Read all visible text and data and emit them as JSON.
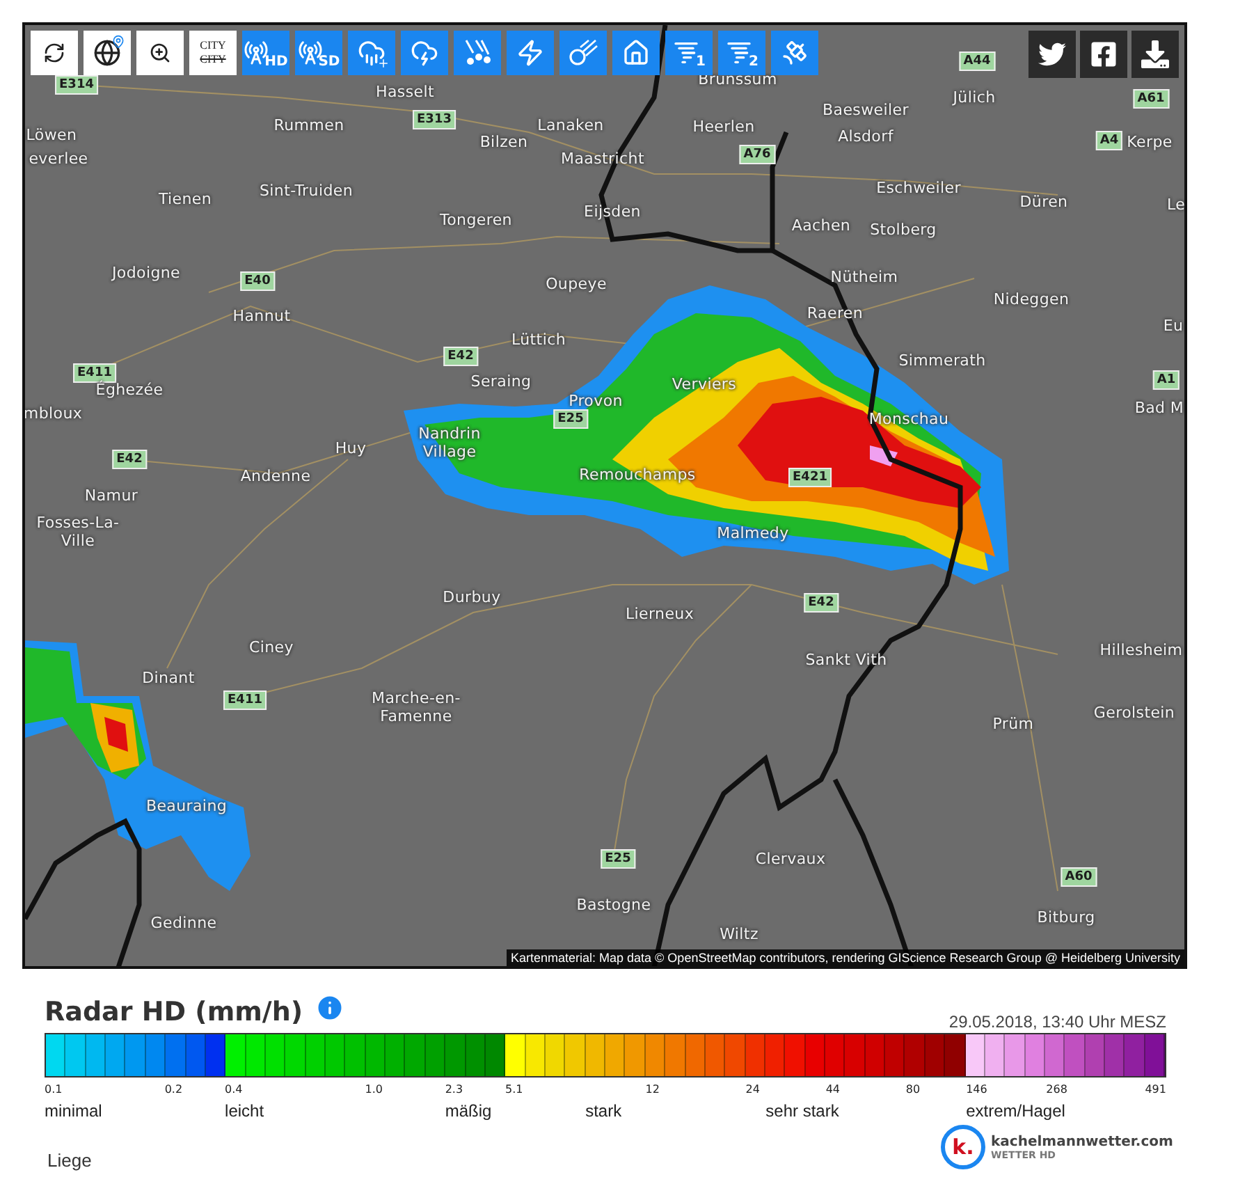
{
  "toolbar": {
    "tools": [
      {
        "kind": "refresh",
        "color": "#ffffff"
      },
      {
        "kind": "globe",
        "color": "#ffffff"
      },
      {
        "kind": "zoom",
        "color": "#ffffff"
      },
      {
        "kind": "city",
        "color": "#ffffff",
        "label": "CITY",
        "struck_label": "CITY"
      },
      {
        "kind": "radar",
        "color": "#1a86f0",
        "label": "HD"
      },
      {
        "kind": "radar",
        "color": "#1a86f0",
        "label": "SD"
      },
      {
        "kind": "cloudplus",
        "color": "#1a86f0"
      },
      {
        "kind": "storm",
        "color": "#1a86f0"
      },
      {
        "kind": "hail",
        "color": "#1a86f0"
      },
      {
        "kind": "lightning",
        "color": "#1a86f0"
      },
      {
        "kind": "meteor",
        "color": "#1a86f0"
      },
      {
        "kind": "flood",
        "color": "#1a86f0"
      },
      {
        "kind": "tornado",
        "color": "#1a86f0",
        "label": "1"
      },
      {
        "kind": "tornado",
        "color": "#1a86f0",
        "label": "2"
      },
      {
        "kind": "satellite",
        "color": "#1a86f0"
      }
    ],
    "share": [
      {
        "kind": "twitter"
      },
      {
        "kind": "facebook"
      },
      {
        "kind": "download"
      }
    ]
  },
  "map": {
    "labels": [
      {
        "kind": "road",
        "text": "E314"
      },
      {
        "kind": "city",
        "text": "Hasselt"
      },
      {
        "kind": "city",
        "text": "Brunssum"
      },
      {
        "kind": "road",
        "text": "A44"
      },
      {
        "kind": "city",
        "text": "Jülich"
      },
      {
        "kind": "road",
        "text": "A61"
      },
      {
        "kind": "city",
        "text": "Löwen"
      },
      {
        "kind": "road",
        "text": "E313"
      },
      {
        "kind": "city",
        "text": "Rummen"
      },
      {
        "kind": "city",
        "text": "Lanaken"
      },
      {
        "kind": "city",
        "text": "Heerlen"
      },
      {
        "kind": "city",
        "text": "Baesweiler"
      },
      {
        "kind": "city",
        "text": "Alsdorf"
      },
      {
        "kind": "city",
        "text": "everlee"
      },
      {
        "kind": "city",
        "text": "Bilzen"
      },
      {
        "kind": "road",
        "text": "A76"
      },
      {
        "kind": "road",
        "text": "A4"
      },
      {
        "kind": "city",
        "text": "Kerpe"
      },
      {
        "kind": "city",
        "text": "Maastricht"
      },
      {
        "kind": "city",
        "text": "Tienen"
      },
      {
        "kind": "city",
        "text": "Sint-Truiden"
      },
      {
        "kind": "city",
        "text": "Eschweiler"
      },
      {
        "kind": "city",
        "text": "Düren"
      },
      {
        "kind": "city",
        "text": "Le"
      },
      {
        "kind": "city",
        "text": "Eijsden"
      },
      {
        "kind": "city",
        "text": "Tongeren"
      },
      {
        "kind": "city",
        "text": "Aachen"
      },
      {
        "kind": "city",
        "text": "Stolberg"
      },
      {
        "kind": "city",
        "text": "Jodoigne"
      },
      {
        "kind": "road",
        "text": "E40"
      },
      {
        "kind": "city",
        "text": "Oupeye"
      },
      {
        "kind": "city",
        "text": "Nütheim"
      },
      {
        "kind": "city",
        "text": "Nideggen"
      },
      {
        "kind": "city",
        "text": "Hannut"
      },
      {
        "kind": "city",
        "text": "Raeren"
      },
      {
        "kind": "city",
        "text": "Eu"
      },
      {
        "kind": "city",
        "text": "Lüttich"
      },
      {
        "kind": "road",
        "text": "E42"
      },
      {
        "kind": "city",
        "text": "Simmerath"
      },
      {
        "kind": "road",
        "text": "E411"
      },
      {
        "kind": "city",
        "text": "Seraing"
      },
      {
        "kind": "city",
        "text": "Verviers"
      },
      {
        "kind": "road",
        "text": "A1"
      },
      {
        "kind": "city",
        "text": "Éghezée"
      },
      {
        "kind": "city",
        "text": "Provon"
      },
      {
        "kind": "city",
        "text": "Bad M"
      },
      {
        "kind": "city",
        "text": "mbloux"
      },
      {
        "kind": "road",
        "text": "E25"
      },
      {
        "kind": "city",
        "text": "Monschau"
      },
      {
        "kind": "road",
        "text": "E42"
      },
      {
        "kind": "city",
        "text": "Huy"
      },
      {
        "kind": "city",
        "text": "Nandrin Village"
      },
      {
        "kind": "city",
        "text": "Andenne"
      },
      {
        "kind": "city",
        "text": "Remouchamps"
      },
      {
        "kind": "road",
        "text": "E421"
      },
      {
        "kind": "city",
        "text": "Namur"
      },
      {
        "kind": "city",
        "text": "Fosses-La-Ville"
      },
      {
        "kind": "city",
        "text": "Malmedy"
      },
      {
        "kind": "city",
        "text": "Durbuy"
      },
      {
        "kind": "road",
        "text": "E42"
      },
      {
        "kind": "city",
        "text": "Lierneux"
      },
      {
        "kind": "city",
        "text": "Ciney"
      },
      {
        "kind": "city",
        "text": "Hillesheim"
      },
      {
        "kind": "city",
        "text": "Sankt Vith"
      },
      {
        "kind": "city",
        "text": "Dinant"
      },
      {
        "kind": "road",
        "text": "E411"
      },
      {
        "kind": "city",
        "text": "Marche-en-Famenne"
      },
      {
        "kind": "city",
        "text": "Gerolstein"
      },
      {
        "kind": "city",
        "text": "Prüm"
      },
      {
        "kind": "city",
        "text": "Beauraing"
      },
      {
        "kind": "road",
        "text": "E25"
      },
      {
        "kind": "city",
        "text": "Clervaux"
      },
      {
        "kind": "road",
        "text": "A60"
      },
      {
        "kind": "city",
        "text": "Bastogne"
      },
      {
        "kind": "city",
        "text": "Bitburg"
      },
      {
        "kind": "city",
        "text": "Gedinne"
      },
      {
        "kind": "city",
        "text": "Wiltz"
      }
    ],
    "attribution": "Kartenmaterial: Map data © OpenStreetMap contributors, rendering GIScience Research Group @ Heidelberg University"
  },
  "legend": {
    "title": "Radar HD (mm/h)",
    "timestamp": "29.05.2018, 13:40 Uhr MESZ",
    "cells": [
      {
        "color": "#00d8f0"
      },
      {
        "color": "#00c8f0"
      },
      {
        "color": "#00b8f0"
      },
      {
        "color": "#00a8f0"
      },
      {
        "color": "#0098f0"
      },
      {
        "color": "#0088f0"
      },
      {
        "color": "#0070f0"
      },
      {
        "color": "#0058f0"
      },
      {
        "color": "#0030f0"
      },
      {
        "color": "#00f000"
      },
      {
        "color": "#00e800"
      },
      {
        "color": "#00e000"
      },
      {
        "color": "#00d800"
      },
      {
        "color": "#00d000"
      },
      {
        "color": "#00c800"
      },
      {
        "color": "#00c000"
      },
      {
        "color": "#00b800"
      },
      {
        "color": "#00b000"
      },
      {
        "color": "#00a800"
      },
      {
        "color": "#00a000"
      },
      {
        "color": "#009800"
      },
      {
        "color": "#009000"
      },
      {
        "color": "#008800"
      },
      {
        "color": "#ffff00"
      },
      {
        "color": "#f8e800"
      },
      {
        "color": "#f0d800"
      },
      {
        "color": "#f0c800"
      },
      {
        "color": "#f0b800"
      },
      {
        "color": "#f0a800"
      },
      {
        "color": "#f09800"
      },
      {
        "color": "#f08800"
      },
      {
        "color": "#f07800"
      },
      {
        "color": "#f06800"
      },
      {
        "color": "#f05800"
      },
      {
        "color": "#f04800"
      },
      {
        "color": "#f03000"
      },
      {
        "color": "#f02000"
      },
      {
        "color": "#f01000"
      },
      {
        "color": "#e80000"
      },
      {
        "color": "#e00000"
      },
      {
        "color": "#d80000"
      },
      {
        "color": "#d00000"
      },
      {
        "color": "#c00000"
      },
      {
        "color": "#b00000"
      },
      {
        "color": "#a00000"
      },
      {
        "color": "#900000"
      },
      {
        "color": "#f8c8f8"
      },
      {
        "color": "#f0b0f0"
      },
      {
        "color": "#e898e8"
      },
      {
        "color": "#e080e0"
      },
      {
        "color": "#d068d0"
      },
      {
        "color": "#c050c0"
      },
      {
        "color": "#b040b0"
      },
      {
        "color": "#a030a8"
      },
      {
        "color": "#9020a0"
      },
      {
        "color": "#801098"
      }
    ],
    "ticks": [
      "0.1",
      "0.2",
      "0.4",
      "1.0",
      "2.3",
      "5.1",
      "12",
      "24",
      "44",
      "80",
      "146",
      "268",
      "491"
    ],
    "categories": [
      "minimal",
      "leicht",
      "mäßig",
      "stark",
      "sehr stark",
      "extrem/Hagel"
    ]
  },
  "footer": {
    "location": "Liege",
    "logo_mark": "k.",
    "logo_name": "kachelmannwetter.com",
    "logo_tagline": "WETTER HD"
  }
}
